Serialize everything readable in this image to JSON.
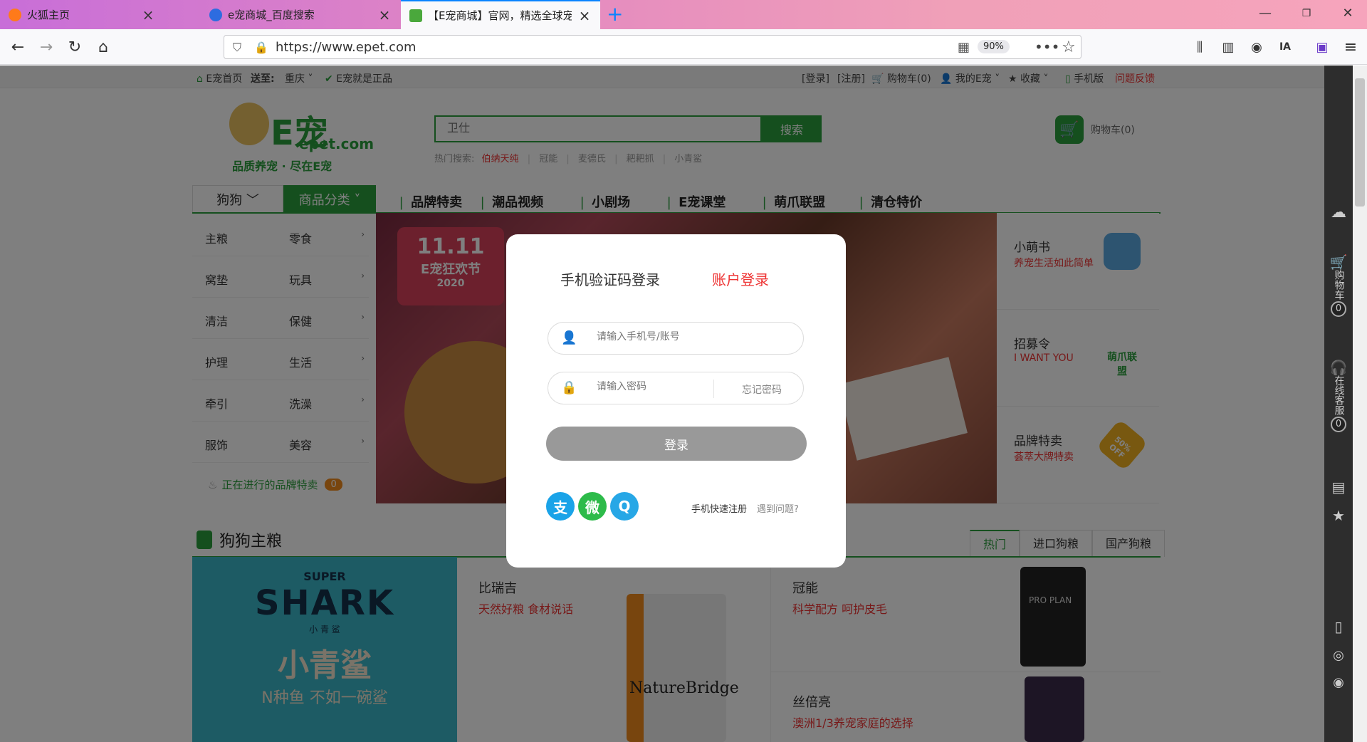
{
  "browser": {
    "tabs": [
      {
        "title": "火狐主页",
        "favicon_color": "#ff7a1a"
      },
      {
        "title": "e宠商城_百度搜索",
        "favicon_color": "#2d6ce0"
      },
      {
        "title": "【E宠商城】官网，精选全球宠",
        "favicon_color": "#4aa83c"
      }
    ],
    "new_tab_glyph": "+",
    "url": "https://www.epet.com",
    "zoom": "90%"
  },
  "topbar": {
    "home": "E宠首页",
    "ship_to_label": "送至:",
    "ship_to_city": "重庆",
    "authentic": "E宠就是正品",
    "login": "[登录]",
    "register": "[注册]",
    "cart": "购物车(0)",
    "my_epet": "我的E宠",
    "favorites": "收藏",
    "mobile": "手机版",
    "feedback": "问题反馈"
  },
  "header": {
    "logo_text": "E宠",
    "logo_domain": "epet.com",
    "logo_slogan": "品质养宠 · 尽在E宠",
    "search_placeholder": "卫仕",
    "search_button": "搜索",
    "hot_label": "热门搜索:",
    "hot_terms": [
      "伯纳天纯",
      "冠能",
      "麦德氏",
      "耙耙抓",
      "小青鲨"
    ],
    "cart_label": "购物车(0)"
  },
  "nav": {
    "pet_select": "狗狗",
    "category": "商品分类",
    "links": [
      "品牌特卖",
      "潮品视频",
      "小剧场",
      "E宠课堂",
      "萌爪联盟",
      "清仓特价"
    ]
  },
  "categories": [
    [
      "主粮",
      "零食"
    ],
    [
      "窝垫",
      "玩具"
    ],
    [
      "清洁",
      "保健"
    ],
    [
      "护理",
      "生活"
    ],
    [
      "牵引",
      "洗澡"
    ],
    [
      "服饰",
      "美容"
    ]
  ],
  "brand_ongoing": {
    "label": "正在进行的品牌特卖",
    "count": "0"
  },
  "banner": {
    "badge_top": "11.11",
    "badge_mid": "E宠狂欢节",
    "badge_year": "2020"
  },
  "promos": [
    {
      "title": "小萌书",
      "subtitle": "养宠生活如此简单",
      "icon_color": "#5aa8e0"
    },
    {
      "title": "招募令",
      "subtitle": "I WANT YOU",
      "icon_color": "#2a9e3c",
      "icon_text": "萌爪联盟"
    },
    {
      "title": "品牌特卖",
      "subtitle": "荟萃大牌特卖",
      "icon_color": "#f0b020",
      "icon_text": "50% OFF"
    }
  ],
  "section": {
    "title": "狗狗主粮",
    "tabs": [
      "热门",
      "进口狗粮",
      "国产狗粮"
    ]
  },
  "shark": {
    "line1": "SUPER",
    "line2": "SHARK",
    "line3": "小 青 鲨",
    "line4": "小青鲨",
    "line5": "N种鱼 不如一碗鲨"
  },
  "products": [
    {
      "name": "比瑞吉",
      "subtitle": "天然好粮 食材说话",
      "image_text": "NatureBridge"
    },
    {
      "name": "冠能",
      "subtitle": "科学配方 呵护皮毛",
      "image_text": "PRO PLAN"
    },
    {
      "name": "丝倍亮",
      "subtitle": "澳洲1/3养宠家庭的选择"
    }
  ],
  "modal": {
    "tab_phone": "手机验证码登录",
    "tab_account": "账户登录",
    "user_placeholder": "请输入手机号/账号",
    "password_placeholder": "请输入密码",
    "forgot": "忘记密码",
    "login_button": "登录",
    "register": "手机快速注册",
    "problem": "遇到问题?",
    "social": [
      {
        "name": "alipay",
        "glyph": "支",
        "color": "#1aa3e8"
      },
      {
        "name": "wechat",
        "glyph": "微",
        "color": "#2dbb4a"
      },
      {
        "name": "qq",
        "glyph": "Q",
        "color": "#27a7e6"
      }
    ]
  },
  "sidebar_tools": {
    "cart_label": "购物车",
    "cart_count": "0",
    "service_label": "在线客服",
    "service_count": "0"
  }
}
